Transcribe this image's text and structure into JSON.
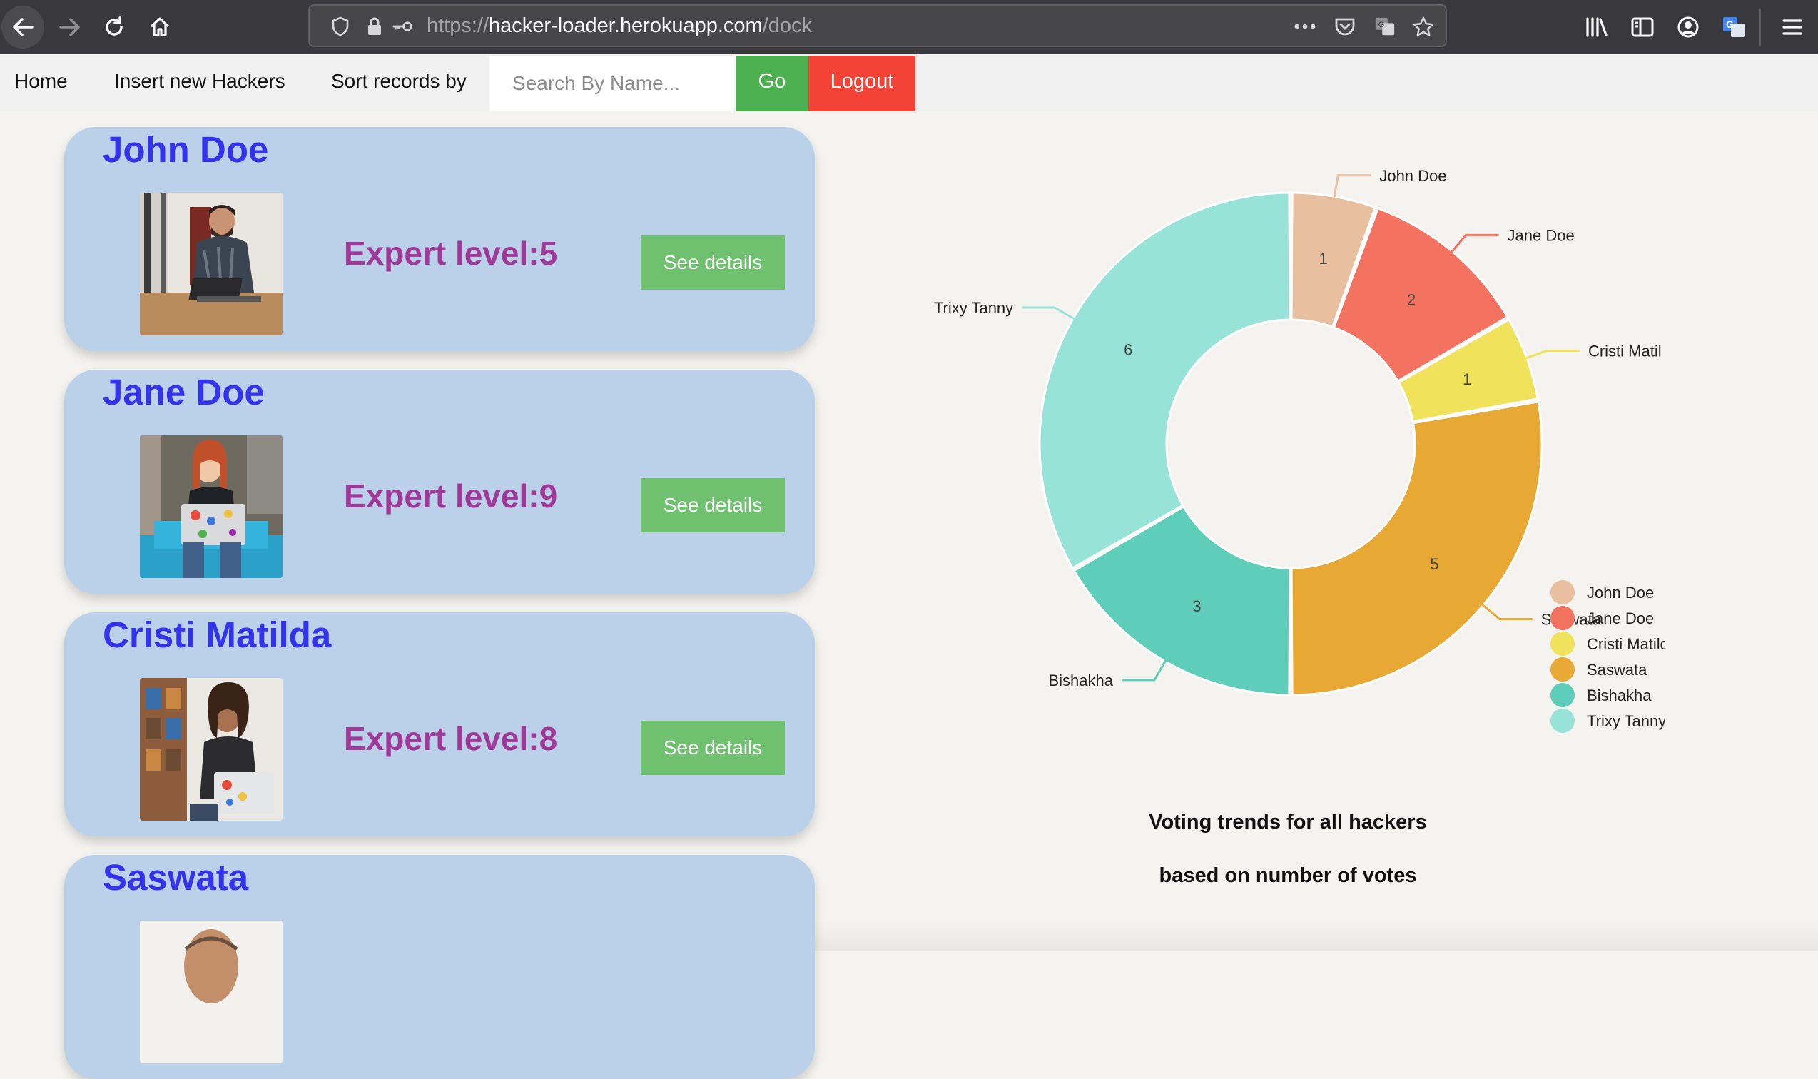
{
  "browser": {
    "url_scheme": "https://",
    "url_host": "hacker-loader.herokuapp.com",
    "url_path": "/dock"
  },
  "navbar": {
    "home_label": "Home",
    "insert_label": "Insert new Hackers",
    "sort_label": "Sort records by",
    "search_placeholder": "Search By Name...",
    "go_label": "Go",
    "logout_label": "Logout"
  },
  "cards": [
    {
      "name": "John Doe",
      "level": "Expert level:5",
      "button": "See details"
    },
    {
      "name": "Jane Doe",
      "level": "Expert level:9",
      "button": "See details"
    },
    {
      "name": "Cristi Matilda",
      "level": "Expert level:8",
      "button": "See details"
    },
    {
      "name": "Saswata",
      "level": "",
      "button": ""
    }
  ],
  "chart_data": {
    "type": "doughnut",
    "categories": [
      "John Doe",
      "Jane Doe",
      "Cristi Matilda",
      "Saswata",
      "Bishakha",
      "Trixy Tanny"
    ],
    "values": [
      1,
      2,
      1,
      5,
      3,
      6
    ],
    "colors": [
      "#e8c0a0",
      "#f47260",
      "#f0e25a",
      "#e8a834",
      "#5ecebb",
      "#98e3d7"
    ],
    "outer_label_text": [
      "John Doe",
      "Jane Doe",
      "Cristi Matil",
      "Saswata",
      "Bishakha",
      "Trixy Tanny"
    ],
    "legend_text": [
      "John Doe",
      "Jane Doe",
      "Cristi Matild",
      "Saswata",
      "Bishakha",
      "Trixy Tanny"
    ],
    "legend_position": "bottom-right"
  },
  "chart_caption": {
    "line1": "Voting trends for all hackers",
    "line2": "based on number of votes"
  }
}
